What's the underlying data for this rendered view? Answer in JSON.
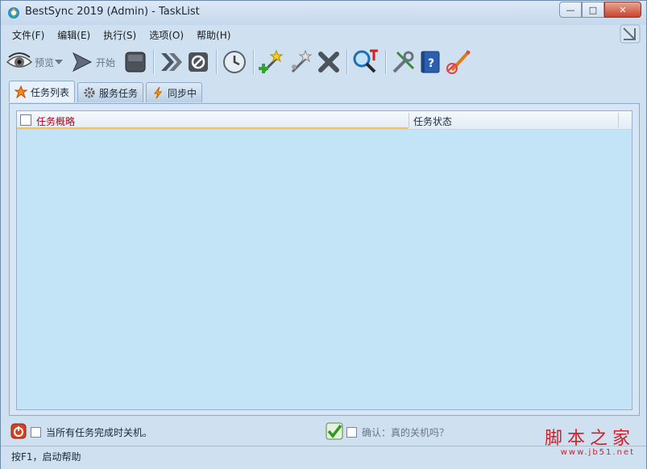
{
  "window": {
    "title": "BestSync 2019 (Admin) - TaskList",
    "controls": {
      "minimize": "—",
      "maximize": "□",
      "close": "✕"
    }
  },
  "menu": [
    {
      "label": "文件(F)"
    },
    {
      "label": "编辑(E)"
    },
    {
      "label": "执行(S)"
    },
    {
      "label": "选项(O)"
    },
    {
      "label": "帮助(H)"
    }
  ],
  "toolbar": {
    "preview_label": "预览",
    "start_label": "开始",
    "icons": [
      "eye-icon",
      "play-icon",
      "stop-icon",
      "fast-forward-icon",
      "cancel-icon",
      "schedule-icon",
      "new-task-icon",
      "edit-task-icon",
      "delete-icon",
      "search-log-icon",
      "settings-icon",
      "help-book-icon",
      "about-icon"
    ]
  },
  "tabs": [
    {
      "label": "任务列表",
      "active": true,
      "icon": "task-star-icon"
    },
    {
      "label": "服务任务",
      "active": false,
      "icon": "gear-icon"
    },
    {
      "label": "同步中",
      "active": false,
      "icon": "sync-bolt-icon"
    }
  ],
  "list": {
    "columns": [
      {
        "label": "任务概略"
      },
      {
        "label": "任务状态"
      }
    ],
    "rows": []
  },
  "bottom": {
    "shutdown_label": "当所有任务完成时关机。",
    "confirm_label": "确认：真的关机吗？",
    "shutdown_checked": false,
    "confirm_checked": false
  },
  "status": {
    "text": "按F1，启动帮助"
  },
  "watermark": {
    "name": "脚本之家",
    "url": "www.jb51.net"
  },
  "colors": {
    "accent_red": "#b3001b",
    "list_bg": "#c3e3f6",
    "window_bg": "#cfe0f0"
  }
}
